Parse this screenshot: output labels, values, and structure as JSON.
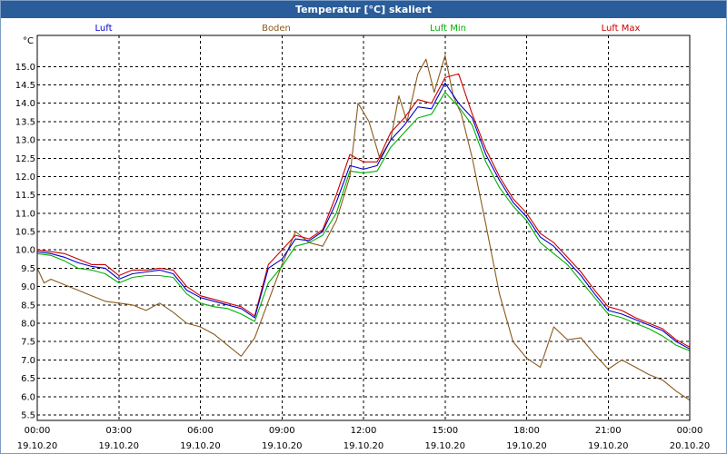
{
  "window": {
    "title": "Temperatur [°C] skaliert"
  },
  "chart_data": {
    "type": "line",
    "ylabel": "°C",
    "ylim": [
      5.35,
      15.85
    ],
    "yticks": [
      "5.5",
      "6.0",
      "6.5",
      "7.0",
      "7.5",
      "8.0",
      "8.5",
      "9.0",
      "9.5",
      "10.0",
      "10.5",
      "11.0",
      "11.5",
      "12.0",
      "12.5",
      "13.0",
      "13.5",
      "14.0",
      "14.5",
      "15.0"
    ],
    "xlim": [
      0,
      24
    ],
    "xticks": [
      {
        "h": 0,
        "time": "00:00",
        "date": "19.10.20"
      },
      {
        "h": 3,
        "time": "03:00",
        "date": "19.10.20"
      },
      {
        "h": 6,
        "time": "06:00",
        "date": "19.10.20"
      },
      {
        "h": 9,
        "time": "09:00",
        "date": "19.10.20"
      },
      {
        "h": 12,
        "time": "12:00",
        "date": "19.10.20"
      },
      {
        "h": 15,
        "time": "15:00",
        "date": "19.10.20"
      },
      {
        "h": 18,
        "time": "18:00",
        "date": "19.10.20"
      },
      {
        "h": 21,
        "time": "21:00",
        "date": "19.10.20"
      },
      {
        "h": 24,
        "time": "00:00",
        "date": "20.10.20"
      }
    ],
    "grid": true,
    "series": [
      {
        "name": "Luft",
        "color": "#0000cc",
        "x": [
          0,
          0.5,
          1,
          1.5,
          2,
          2.5,
          3,
          3.5,
          4,
          4.5,
          5,
          5.5,
          6,
          6.5,
          7,
          7.5,
          8,
          8.5,
          9,
          9.5,
          10,
          10.5,
          11,
          11.5,
          12,
          12.5,
          13,
          13.5,
          14,
          14.5,
          15,
          15.5,
          16,
          16.5,
          17,
          17.5,
          18,
          18.5,
          19,
          19.5,
          20,
          20.5,
          21,
          21.5,
          22,
          22.5,
          23,
          23.5,
          24
        ],
        "y": [
          9.95,
          9.9,
          9.8,
          9.65,
          9.55,
          9.5,
          9.2,
          9.35,
          9.4,
          9.45,
          9.35,
          8.9,
          8.7,
          8.6,
          8.5,
          8.4,
          8.15,
          9.5,
          9.75,
          10.3,
          10.25,
          10.5,
          11.3,
          12.3,
          12.2,
          12.3,
          13.0,
          13.4,
          13.9,
          13.85,
          14.55,
          14.0,
          13.6,
          12.6,
          11.9,
          11.3,
          10.9,
          10.35,
          10.1,
          9.7,
          9.3,
          8.8,
          8.35,
          8.25,
          8.1,
          7.95,
          7.8,
          7.5,
          7.3
        ]
      },
      {
        "name": "Boden",
        "color": "#8b5a1e",
        "x": [
          0,
          0.25,
          0.5,
          1,
          1.5,
          2,
          2.5,
          3,
          3.5,
          4,
          4.5,
          5,
          5.5,
          6,
          6.5,
          7,
          7.5,
          8,
          8.5,
          9,
          9.5,
          10,
          10.5,
          11,
          11.5,
          11.8,
          12.2,
          12.6,
          13,
          13.3,
          13.6,
          14,
          14.3,
          14.6,
          15,
          15.3,
          15.6,
          16,
          16.5,
          17,
          17.5,
          18,
          18.5,
          19,
          19.5,
          20,
          20.5,
          21,
          21.5,
          22,
          22.5,
          23,
          23.5,
          24
        ],
        "y": [
          9.5,
          9.1,
          9.2,
          9.05,
          8.9,
          8.75,
          8.6,
          8.55,
          8.5,
          8.35,
          8.55,
          8.3,
          8.0,
          7.9,
          7.7,
          7.4,
          7.1,
          7.6,
          8.6,
          9.6,
          10.5,
          10.2,
          10.1,
          10.8,
          12.0,
          14.0,
          13.5,
          12.5,
          13.0,
          14.2,
          13.5,
          14.8,
          15.2,
          14.3,
          15.3,
          14.2,
          13.7,
          12.5,
          10.7,
          8.8,
          7.5,
          7.05,
          6.8,
          7.9,
          7.55,
          7.6,
          7.15,
          6.75,
          7.0,
          6.8,
          6.6,
          6.45,
          6.15,
          5.9
        ]
      },
      {
        "name": "Luft Min",
        "color": "#00b000",
        "x": [
          0,
          0.5,
          1,
          1.5,
          2,
          2.5,
          3,
          3.5,
          4,
          4.5,
          5,
          5.5,
          6,
          6.5,
          7,
          7.5,
          8,
          8.5,
          9,
          9.5,
          10,
          10.5,
          11,
          11.5,
          12,
          12.5,
          13,
          13.5,
          14,
          14.5,
          15,
          15.5,
          16,
          16.5,
          17,
          17.5,
          18,
          18.5,
          19,
          19.5,
          20,
          20.5,
          21,
          21.5,
          22,
          22.5,
          23,
          23.5,
          24
        ],
        "y": [
          9.9,
          9.85,
          9.7,
          9.5,
          9.45,
          9.35,
          9.1,
          9.25,
          9.3,
          9.3,
          9.25,
          8.8,
          8.55,
          8.45,
          8.4,
          8.25,
          8.05,
          9.1,
          9.55,
          10.1,
          10.2,
          10.4,
          11.0,
          12.15,
          12.1,
          12.15,
          12.8,
          13.2,
          13.6,
          13.7,
          14.3,
          13.9,
          13.4,
          12.4,
          11.7,
          11.2,
          10.8,
          10.2,
          9.9,
          9.6,
          9.15,
          8.7,
          8.25,
          8.15,
          8.0,
          7.85,
          7.65,
          7.4,
          7.25
        ]
      },
      {
        "name": "Luft Max",
        "color": "#cc0000",
        "x": [
          0,
          0.5,
          1,
          1.5,
          2,
          2.5,
          3,
          3.5,
          4,
          4.5,
          5,
          5.5,
          6,
          6.5,
          7,
          7.5,
          8,
          8.5,
          9,
          9.5,
          10,
          10.5,
          11,
          11.5,
          12,
          12.5,
          13,
          13.5,
          14,
          14.5,
          15,
          15.5,
          16,
          16.5,
          17,
          17.5,
          18,
          18.5,
          19,
          19.5,
          20,
          20.5,
          21,
          21.5,
          22,
          22.5,
          23,
          23.5,
          24
        ],
        "y": [
          10.0,
          9.95,
          9.9,
          9.75,
          9.6,
          9.6,
          9.3,
          9.45,
          9.45,
          9.5,
          9.45,
          9.0,
          8.75,
          8.65,
          8.55,
          8.45,
          8.2,
          9.6,
          10.0,
          10.4,
          10.3,
          10.55,
          11.5,
          12.6,
          12.4,
          12.4,
          13.2,
          13.6,
          14.1,
          14.0,
          14.7,
          14.8,
          13.7,
          12.75,
          12.0,
          11.4,
          11.0,
          10.45,
          10.2,
          9.8,
          9.4,
          8.9,
          8.45,
          8.35,
          8.15,
          8.0,
          7.85,
          7.55,
          7.35
        ]
      }
    ]
  }
}
